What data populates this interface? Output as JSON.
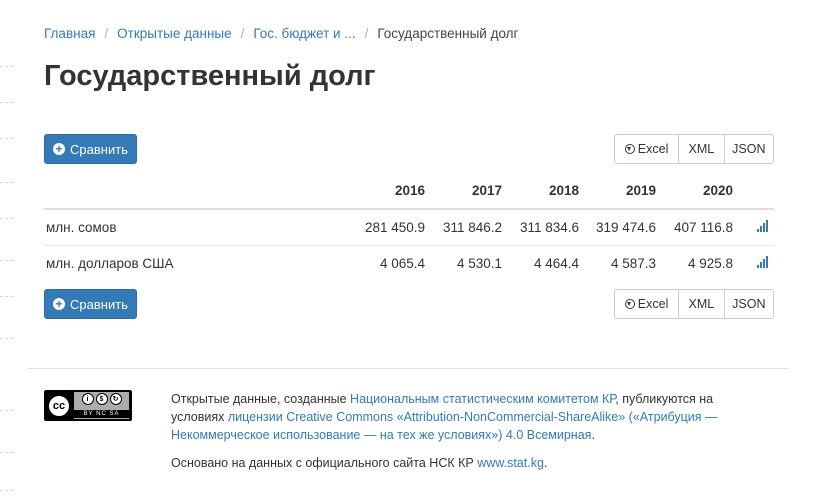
{
  "breadcrumb": {
    "home": "Главная",
    "open_data": "Открытые данные",
    "budget": "Гос. бюджет и ...",
    "current": "Государственный долг",
    "separator": "/"
  },
  "page_title": "Государственный долг",
  "compare_label": "Сравнить",
  "export": {
    "excel": "Excel",
    "xml": "XML",
    "json": "JSON"
  },
  "table": {
    "years": [
      "2016",
      "2017",
      "2018",
      "2019",
      "2020"
    ],
    "rows": [
      {
        "label": "млн. сомов",
        "values": [
          "281 450.9",
          "311 846.2",
          "311 834.6",
          "319 474.6",
          "407 116.8"
        ]
      },
      {
        "label": "млн. долларов США",
        "values": [
          "4 065.4",
          "4 530.1",
          "4 464.4",
          "4 587.3",
          "4 925.8"
        ]
      }
    ]
  },
  "footer": {
    "license_p1": "Открытые данные, созданные ",
    "nsc_link": "Национальным статистическим комитетом КР",
    "license_p2": ", публикуются на условиях ",
    "license_link": "лицензии Creative Commons «Attribution-NonCommercial-ShareAlike» («Атрибуция — Некоммерческое использование — на тех же условиях») 4.0 Всемирная",
    "license_p3": ".",
    "source_text": "Основано на данных с официального сайта НСК КР ",
    "source_link": "www.stat.kg",
    "source_end": ".",
    "cc_badge_text": "BY  NC  SA",
    "cc_text": "cc"
  },
  "colors": {
    "accent": "#337ab7",
    "border": "#cccccc"
  }
}
